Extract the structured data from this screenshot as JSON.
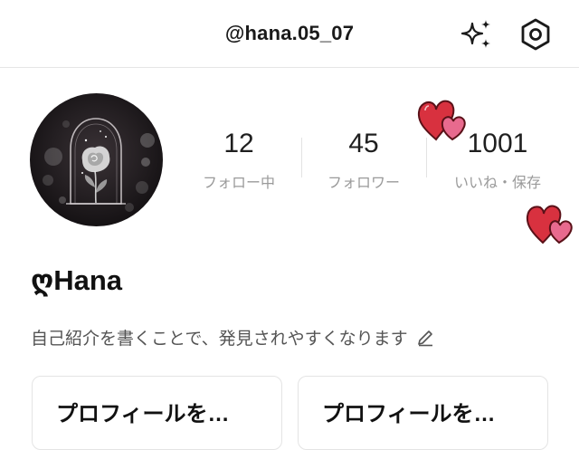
{
  "header": {
    "username": "@hana.05_07",
    "sparkle_icon": "sparkle-icon",
    "settings_icon": "hexagon-settings-icon"
  },
  "profile": {
    "avatar_icon": "rose-under-glass-avatar",
    "display_name": "ღHana",
    "bio_placeholder": "自己紹介を書くことで、発見されやすくなります",
    "edit_icon": "pencil-icon"
  },
  "stats": [
    {
      "value": "12",
      "label": "フォロー中"
    },
    {
      "value": "45",
      "label": "フォロワー"
    },
    {
      "value": "1001",
      "label": "いいね・保存"
    }
  ],
  "cards": [
    {
      "title": "プロフィールを…"
    },
    {
      "title": "プロフィールを…"
    }
  ],
  "colors": {
    "heart_red": "#d8313f",
    "heart_pink": "#e86a8e"
  }
}
